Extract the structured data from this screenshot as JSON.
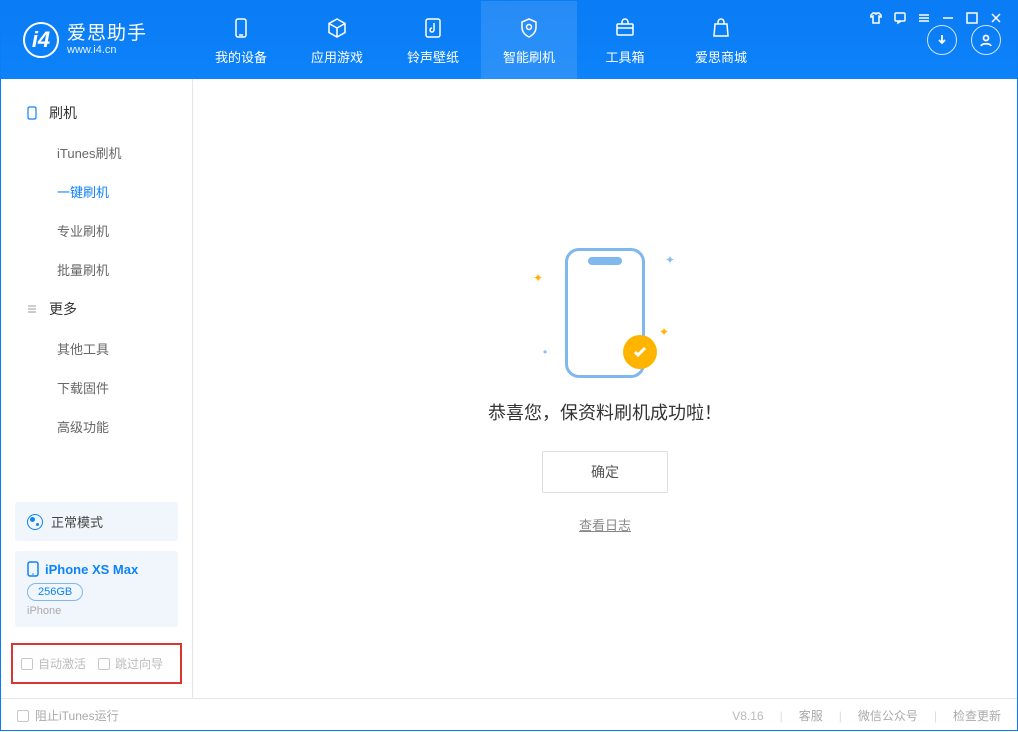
{
  "app": {
    "name_cn": "爱思助手",
    "name_en": "www.i4.cn",
    "logo_letter": "i4"
  },
  "nav": {
    "tabs": [
      {
        "label": "我的设备",
        "icon": "device-icon"
      },
      {
        "label": "应用游戏",
        "icon": "cube-icon"
      },
      {
        "label": "铃声壁纸",
        "icon": "music-icon"
      },
      {
        "label": "智能刷机",
        "icon": "gear-shield-icon",
        "active": true
      },
      {
        "label": "工具箱",
        "icon": "toolbox-icon"
      },
      {
        "label": "爱思商城",
        "icon": "bag-icon"
      }
    ]
  },
  "sidebar": {
    "groups": [
      {
        "title": "刷机",
        "icon": "phone-icon",
        "items": [
          {
            "label": "iTunes刷机"
          },
          {
            "label": "一键刷机",
            "active": true
          },
          {
            "label": "专业刷机"
          },
          {
            "label": "批量刷机"
          }
        ]
      },
      {
        "title": "更多",
        "icon": "list-icon",
        "items": [
          {
            "label": "其他工具"
          },
          {
            "label": "下载固件"
          },
          {
            "label": "高级功能"
          }
        ]
      }
    ],
    "mode_label": "正常模式",
    "device": {
      "name": "iPhone XS Max",
      "storage": "256GB",
      "type": "iPhone"
    },
    "checks": {
      "auto_activate": "自动激活",
      "skip_guide": "跳过向导"
    }
  },
  "content": {
    "message": "恭喜您，保资料刷机成功啦！",
    "ok_label": "确定",
    "log_link": "查看日志"
  },
  "footer": {
    "block_itunes": "阻止iTunes运行",
    "version": "V8.16",
    "links": [
      "客服",
      "微信公众号",
      "检查更新"
    ]
  }
}
